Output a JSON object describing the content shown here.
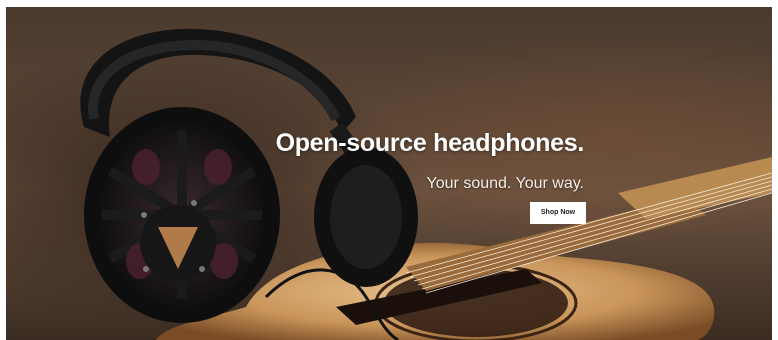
{
  "hero": {
    "title": "Open-source headphones.",
    "subtitle": "Your sound. Your way.",
    "cta_label": "Shop Now",
    "image_subject": "headphones-on-acoustic-guitar"
  },
  "colors": {
    "background": "#5a4535",
    "title_text": "#ffffff",
    "button_bg": "#ffffff",
    "button_text": "#222222"
  }
}
